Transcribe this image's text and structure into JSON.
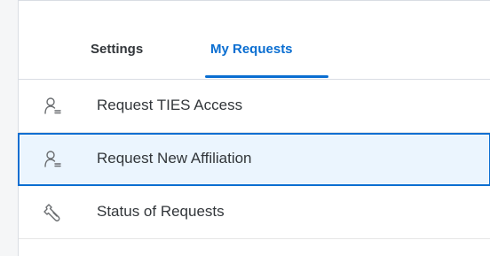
{
  "tabs": [
    {
      "label": "Settings",
      "active": false
    },
    {
      "label": "My Requests",
      "active": true
    }
  ],
  "menu": {
    "items": [
      {
        "label": "Request TIES Access",
        "icon": "person-list-icon",
        "selected": false
      },
      {
        "label": "Request New Affiliation",
        "icon": "person-list-icon",
        "selected": true
      },
      {
        "label": "Status of Requests",
        "icon": "wrench-icon",
        "selected": false
      }
    ]
  },
  "colors": {
    "accent": "#0a6ed1",
    "text": "#32363a",
    "icon": "#6a6d70",
    "selected_bg": "#ebf5fe"
  }
}
